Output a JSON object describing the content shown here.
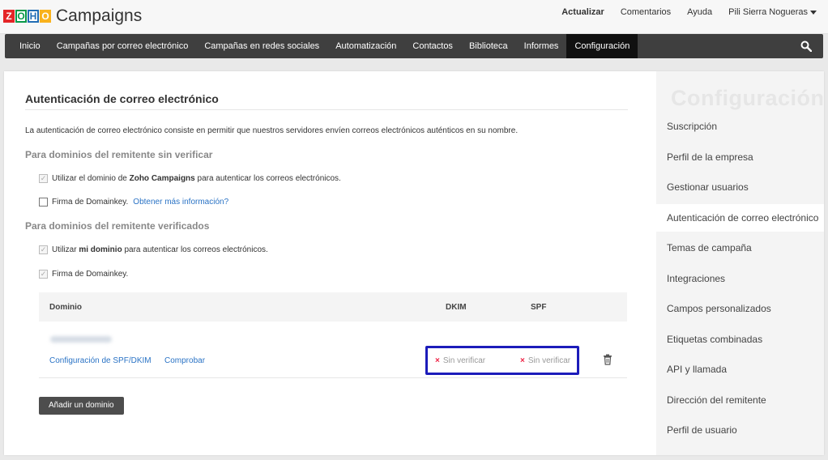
{
  "app": {
    "logo_letters": [
      "Z",
      "O",
      "H",
      "O"
    ],
    "name": "Campaigns"
  },
  "toplinks": {
    "update": "Actualizar",
    "comments": "Comentarios",
    "help": "Ayuda",
    "user": "Pili Sierra Nogueras"
  },
  "nav": {
    "items": [
      {
        "label": "Inicio"
      },
      {
        "label": "Campañas por correo electrónico"
      },
      {
        "label": "Campañas en redes sociales"
      },
      {
        "label": "Automatización"
      },
      {
        "label": "Contactos"
      },
      {
        "label": "Biblioteca"
      },
      {
        "label": "Informes"
      },
      {
        "label": "Configuración",
        "active": true
      }
    ],
    "search_icon": "search-icon"
  },
  "main": {
    "title": "Autenticación de correo electrónico",
    "description": "La autenticación de correo electrónico consiste en permitir que nuestros servidores envíen correos electrónicos auténticos en su nombre.",
    "unverified_heading": "Para dominios del remitente sin verificar",
    "opt1_prefix": "Utilizar el dominio de",
    "opt1_bold": "Zoho Campaigns",
    "opt1_suffix": "para autenticar los correos electrónicos.",
    "opt2_label": "Firma de Domainkey.",
    "opt2_link": "Obtener más información?",
    "verified_heading": "Para dominios del remitente verificados",
    "opt3_prefix": "Utilizar",
    "opt3_bold": "mi dominio",
    "opt3_suffix": "para autenticar los correos electrónicos.",
    "opt4_label": "Firma de Domainkey.",
    "table": {
      "col_domain": "Dominio",
      "col_dkim": "DKIM",
      "col_spf": "SPF",
      "row": {
        "config_link": "Configuración de SPF/DKIM",
        "check_link": "Comprobar",
        "dkim_status": "Sin verificar",
        "spf_status": "Sin verificar"
      }
    },
    "add_domain_button": "Añadir un dominio"
  },
  "sidebar": {
    "title": "Configuración",
    "items": [
      {
        "label": "Suscripción"
      },
      {
        "label": "Perfil de la empresa"
      },
      {
        "label": "Gestionar usuarios"
      },
      {
        "label": "Autenticación de correo electrónico",
        "active": true
      },
      {
        "label": "Temas de campaña"
      },
      {
        "label": "Integraciones"
      },
      {
        "label": "Campos personalizados"
      },
      {
        "label": "Etiquetas combinadas"
      },
      {
        "label": "API y llamada"
      },
      {
        "label": "Dirección del remitente"
      },
      {
        "label": "Perfil de usuario"
      }
    ]
  },
  "colors": {
    "nav_bg": "#3f3f3f",
    "link": "#2a73c5",
    "highlight_border": "#1c1cba",
    "error_x": "#ee2244"
  }
}
